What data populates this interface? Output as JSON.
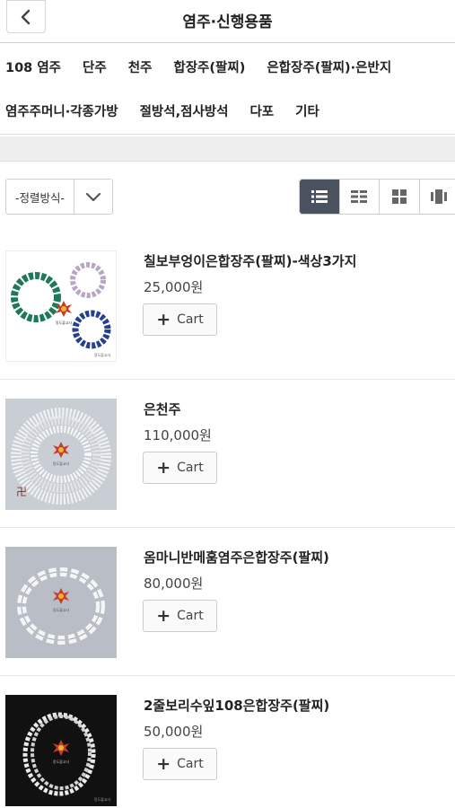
{
  "header": {
    "title": "염주·신행용품",
    "back_icon": "chevron-left-icon"
  },
  "categories": {
    "row1": [
      "108 염주",
      "단주",
      "천주",
      "합장주(팔찌)",
      "은합장주(팔찌)·은반지"
    ],
    "row2": [
      "염주주머니·각종가방",
      "절방석,점사방석",
      "다포",
      "기타"
    ]
  },
  "sort": {
    "label": "-정렬방식-",
    "icon": "chevron-down-icon"
  },
  "view_modes": [
    {
      "icon": "list-view-icon",
      "active": true
    },
    {
      "icon": "small-grid-icon",
      "active": false
    },
    {
      "icon": "large-grid-icon",
      "active": false
    },
    {
      "icon": "gallery-view-icon",
      "active": false
    }
  ],
  "products": [
    {
      "name": "칠보부엉이은합장주(팔찌)-색상3가지",
      "price": "25,000원",
      "cart_label": "Cart",
      "watermark": "정도불교사"
    },
    {
      "name": "은천주",
      "price": "110,000원",
      "cart_label": "Cart",
      "watermark": "정도불교사"
    },
    {
      "name": "옴마니반메훔염주은합장주(팔찌)",
      "price": "80,000원",
      "cart_label": "Cart",
      "watermark": "정도불교사"
    },
    {
      "name": "2줄보리수잎108은합장주(팔찌)",
      "price": "50,000원",
      "cart_label": "Cart",
      "watermark": "정도불교사"
    }
  ],
  "colors": {
    "active_view": "#4a5260",
    "header_border": "#cfcfcf",
    "gray_band": "#eeeeee"
  }
}
